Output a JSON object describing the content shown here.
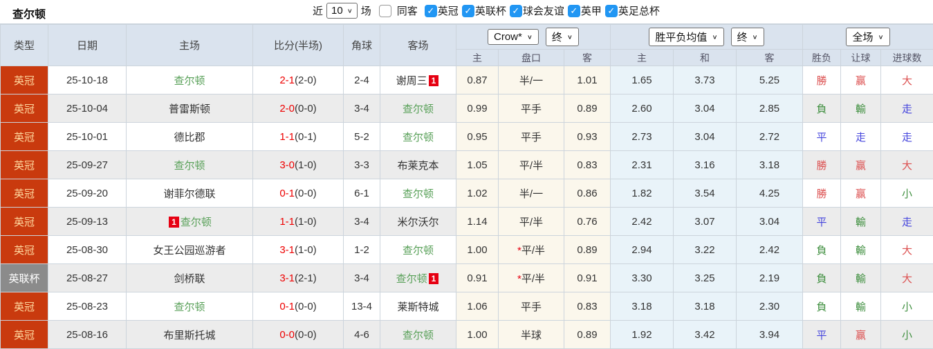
{
  "top_bar": {
    "title": "查尔顿",
    "recent_label": "近",
    "recent_value": "10",
    "matches_label": "场",
    "same_opponent": {
      "label": "同客",
      "checked": false
    },
    "leagues": [
      {
        "label": "英冠",
        "checked": true
      },
      {
        "label": "英联杯",
        "checked": true
      },
      {
        "label": "球会友谊",
        "checked": true
      },
      {
        "label": "英甲",
        "checked": true
      },
      {
        "label": "英足总杯",
        "checked": true
      }
    ]
  },
  "table": {
    "merged_headers": [
      "类型",
      "日期",
      "主场",
      "比分(半场)",
      "角球",
      "客场"
    ],
    "odds_company_dropdown": "Crow*",
    "odds_final_dropdown": "终",
    "avg_dropdown": "胜平负均值",
    "avg_final_dropdown": "终",
    "fullmatch_dropdown": "全场",
    "sub_headers": [
      "主",
      "盘口",
      "客",
      "主",
      "和",
      "客",
      "胜负",
      "让球",
      "进球数"
    ],
    "rows": [
      {
        "type": "英冠",
        "date": "25-10-18",
        "home": {
          "name": "查尔顿",
          "green": true
        },
        "score": "2-1",
        "half": "(2-0)",
        "corners": "2-4",
        "away": {
          "name": "谢周三",
          "badge": "1"
        },
        "odds": {
          "home": "0.87",
          "handicap": "半/一",
          "star": false,
          "away": "1.01"
        },
        "avg": {
          "home": "1.65",
          "draw": "3.73",
          "away": "5.25"
        },
        "results": [
          [
            "勝",
            "r"
          ],
          [
            "赢",
            "r"
          ],
          [
            "大",
            "r"
          ]
        ]
      },
      {
        "type": "英冠",
        "date": "25-10-04",
        "home": {
          "name": "普雷斯顿"
        },
        "score": "2-0",
        "half": "(0-0)",
        "corners": "3-4",
        "away": {
          "name": "查尔顿",
          "green": true
        },
        "odds": {
          "home": "0.99",
          "handicap": "平手",
          "star": false,
          "away": "0.89"
        },
        "avg": {
          "home": "2.60",
          "draw": "3.04",
          "away": "2.85"
        },
        "results": [
          [
            "負",
            "g"
          ],
          [
            "輸",
            "g"
          ],
          [
            "走",
            "b"
          ]
        ]
      },
      {
        "type": "英冠",
        "date": "25-10-01",
        "home": {
          "name": "德比郡"
        },
        "score": "1-1",
        "half": "(0-1)",
        "corners": "5-2",
        "away": {
          "name": "查尔顿",
          "green": true
        },
        "odds": {
          "home": "0.95",
          "handicap": "平手",
          "star": false,
          "away": "0.93"
        },
        "avg": {
          "home": "2.73",
          "draw": "3.04",
          "away": "2.72"
        },
        "results": [
          [
            "平",
            "b"
          ],
          [
            "走",
            "b"
          ],
          [
            "走",
            "b"
          ]
        ]
      },
      {
        "type": "英冠",
        "date": "25-09-27",
        "home": {
          "name": "查尔顿",
          "green": true
        },
        "score": "3-0",
        "half": "(1-0)",
        "corners": "3-3",
        "away": {
          "name": "布莱克本"
        },
        "odds": {
          "home": "1.05",
          "handicap": "平/半",
          "star": false,
          "away": "0.83"
        },
        "avg": {
          "home": "2.31",
          "draw": "3.16",
          "away": "3.18"
        },
        "results": [
          [
            "勝",
            "r"
          ],
          [
            "赢",
            "r"
          ],
          [
            "大",
            "r"
          ]
        ]
      },
      {
        "type": "英冠",
        "date": "25-09-20",
        "home": {
          "name": "谢菲尔德联"
        },
        "score": "0-1",
        "half": "(0-0)",
        "corners": "6-1",
        "away": {
          "name": "查尔顿",
          "green": true
        },
        "odds": {
          "home": "1.02",
          "handicap": "半/一",
          "star": false,
          "away": "0.86"
        },
        "avg": {
          "home": "1.82",
          "draw": "3.54",
          "away": "4.25"
        },
        "results": [
          [
            "勝",
            "r"
          ],
          [
            "赢",
            "r"
          ],
          [
            "小",
            "g"
          ]
        ]
      },
      {
        "type": "英冠",
        "date": "25-09-13",
        "home": {
          "name": "查尔顿",
          "green": true,
          "badge": "1",
          "badge_pos": "before"
        },
        "score": "1-1",
        "half": "(1-0)",
        "corners": "3-4",
        "away": {
          "name": "米尔沃尔"
        },
        "odds": {
          "home": "1.14",
          "handicap": "平/半",
          "star": false,
          "away": "0.76"
        },
        "avg": {
          "home": "2.42",
          "draw": "3.07",
          "away": "3.04"
        },
        "results": [
          [
            "平",
            "b"
          ],
          [
            "輸",
            "g"
          ],
          [
            "走",
            "b"
          ]
        ]
      },
      {
        "type": "英冠",
        "date": "25-08-30",
        "home": {
          "name": "女王公园巡游者"
        },
        "score": "3-1",
        "half": "(1-0)",
        "corners": "1-2",
        "away": {
          "name": "查尔顿",
          "green": true
        },
        "odds": {
          "home": "1.00",
          "handicap": "平/半",
          "star": true,
          "away": "0.89"
        },
        "avg": {
          "home": "2.94",
          "draw": "3.22",
          "away": "2.42"
        },
        "results": [
          [
            "負",
            "g"
          ],
          [
            "輸",
            "g"
          ],
          [
            "大",
            "r"
          ]
        ]
      },
      {
        "type": "英联杯",
        "type_gray": true,
        "date": "25-08-27",
        "home": {
          "name": "剑桥联"
        },
        "score": "3-1",
        "half": "(2-1)",
        "corners": "3-4",
        "away": {
          "name": "查尔顿",
          "green": true,
          "badge": "1"
        },
        "odds": {
          "home": "0.91",
          "handicap": "平/半",
          "star": true,
          "away": "0.91"
        },
        "avg": {
          "home": "3.30",
          "draw": "3.25",
          "away": "2.19"
        },
        "results": [
          [
            "負",
            "g"
          ],
          [
            "輸",
            "g"
          ],
          [
            "大",
            "r"
          ]
        ]
      },
      {
        "type": "英冠",
        "date": "25-08-23",
        "home": {
          "name": "查尔顿",
          "green": true
        },
        "score": "0-1",
        "half": "(0-0)",
        "corners": "13-4",
        "away": {
          "name": "莱斯特城"
        },
        "odds": {
          "home": "1.06",
          "handicap": "平手",
          "star": false,
          "away": "0.83"
        },
        "avg": {
          "home": "3.18",
          "draw": "3.18",
          "away": "2.30"
        },
        "results": [
          [
            "負",
            "g"
          ],
          [
            "輸",
            "g"
          ],
          [
            "小",
            "g"
          ]
        ]
      },
      {
        "type": "英冠",
        "date": "25-08-16",
        "home": {
          "name": "布里斯托城"
        },
        "score": "0-0",
        "half": "(0-0)",
        "corners": "4-6",
        "away": {
          "name": "查尔顿",
          "green": true
        },
        "odds": {
          "home": "1.00",
          "handicap": "半球",
          "star": false,
          "away": "0.89"
        },
        "avg": {
          "home": "1.92",
          "draw": "3.42",
          "away": "3.94"
        },
        "results": [
          [
            "平",
            "b"
          ],
          [
            "赢",
            "r"
          ],
          [
            "小",
            "g"
          ]
        ]
      }
    ]
  },
  "colors": {
    "league_red_bg": "#c93a0e",
    "league_gray_bg": "#8b8b8b",
    "header_bg": "#dae3ee",
    "odds_col_bg": "#fbf7ec",
    "avg_col_bg": "#e9f3f9",
    "team_green": "#58a058",
    "score_red": "#ee0000",
    "result_win_red": "#dc5050",
    "result_lose_green": "#3f8f3f",
    "result_draw_blue": "#4545dd",
    "checkbox_blue": "#2196f3"
  }
}
